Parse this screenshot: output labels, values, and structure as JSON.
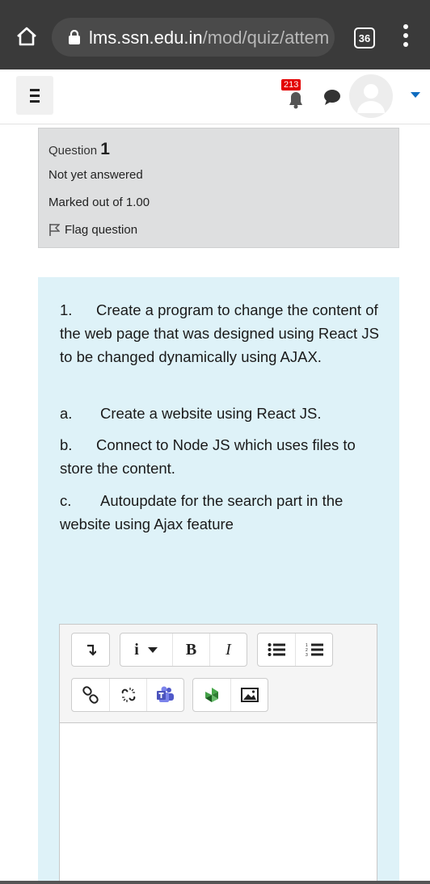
{
  "browser": {
    "url_host": "lms.ssn.edu.in",
    "url_path": "/mod/quiz/attem",
    "tab_count": "36"
  },
  "header": {
    "notification_count": "213"
  },
  "question_info": {
    "label": "Question",
    "number": "1",
    "state": "Not yet answered",
    "grade": "Marked out of 1.00",
    "flag_label": "Flag question"
  },
  "question": {
    "item1_num": "1.",
    "item1_text": "Create a program to change the content of the web page that was designed using React JS to be changed dynamically using AJAX.",
    "item_a_num": "a.",
    "item_a_text": "Create a website using React JS.",
    "item_b_num": "b.",
    "item_b_text": "Connect to Node JS which uses files to store the content.",
    "item_c_num": "c.",
    "item_c_text": "Autoupdate for the search part in the website using Ajax feature"
  },
  "editor": {
    "bold_label": "B",
    "italic_label": "I",
    "info_label": "i",
    "toolbar_icons": [
      "collapse-icon",
      "info-style-icon",
      "bold-icon",
      "italic-icon",
      "unordered-list-icon",
      "ordered-list-icon",
      "link-icon",
      "unlink-icon",
      "teams-icon",
      "media-icon",
      "image-icon"
    ],
    "answer_text": ""
  },
  "colors": {
    "browser_bar": "#3a3a3a",
    "info_box": "#dedfe0",
    "content_box": "#def2f8",
    "badge": "#e30000",
    "accent": "#0f6cbf"
  }
}
